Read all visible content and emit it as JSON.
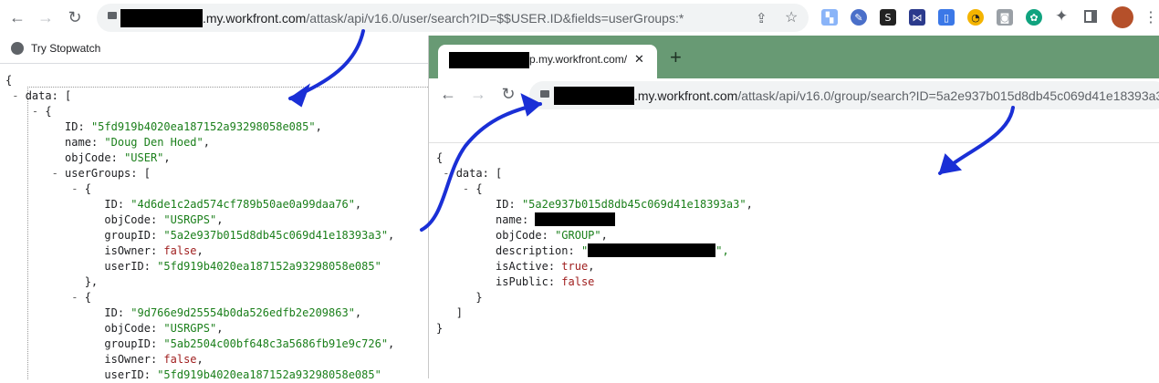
{
  "main_window": {
    "url_domain_suffix": ".my.workfront.com",
    "url_path": "/attask/api/v16.0/user/search?ID=$$USER.ID&fields=userGroups:*",
    "bookmark": {
      "label": "Try Stopwatch",
      "icon": "globe-icon"
    },
    "json_lines": [
      {
        "toggle": "",
        "indent": 0,
        "key": "",
        "value": "{",
        "vtype": "punct",
        "suffix": ""
      },
      {
        "toggle": "-",
        "indent": 1,
        "key": "data",
        "value": "[",
        "vtype": "punct",
        "suffix": ""
      },
      {
        "toggle": "-",
        "indent": 2,
        "key": "",
        "value": "{",
        "vtype": "punct",
        "suffix": ""
      },
      {
        "toggle": "",
        "indent": 3,
        "key": "ID",
        "value": "\"5fd919b4020ea187152a93298058e085\"",
        "vtype": "string",
        "suffix": ","
      },
      {
        "toggle": "",
        "indent": 3,
        "key": "name",
        "value": "\"Doug Den Hoed\"",
        "vtype": "string",
        "suffix": ","
      },
      {
        "toggle": "",
        "indent": 3,
        "key": "objCode",
        "value": "\"USER\"",
        "vtype": "string",
        "suffix": ","
      },
      {
        "toggle": "-",
        "indent": 3,
        "key": "userGroups",
        "value": "[",
        "vtype": "punct",
        "suffix": ""
      },
      {
        "toggle": "-",
        "indent": 4,
        "key": "",
        "value": "{",
        "vtype": "punct",
        "suffix": ""
      },
      {
        "toggle": "",
        "indent": 5,
        "key": "ID",
        "value": "\"4d6de1c2ad574cf789b50ae0a99daa76\"",
        "vtype": "string",
        "suffix": ","
      },
      {
        "toggle": "",
        "indent": 5,
        "key": "objCode",
        "value": "\"USRGPS\"",
        "vtype": "string",
        "suffix": ","
      },
      {
        "toggle": "",
        "indent": 5,
        "key": "groupID",
        "value": "\"5a2e937b015d8db45c069d41e18393a3\"",
        "vtype": "string",
        "suffix": ","
      },
      {
        "toggle": "",
        "indent": 5,
        "key": "isOwner",
        "value": "false",
        "vtype": "bool",
        "suffix": ","
      },
      {
        "toggle": "",
        "indent": 5,
        "key": "userID",
        "value": "\"5fd919b4020ea187152a93298058e085\"",
        "vtype": "string",
        "suffix": ""
      },
      {
        "toggle": "",
        "indent": 4,
        "key": "",
        "value": "},",
        "vtype": "punct",
        "suffix": ""
      },
      {
        "toggle": "-",
        "indent": 4,
        "key": "",
        "value": "{",
        "vtype": "punct",
        "suffix": ""
      },
      {
        "toggle": "",
        "indent": 5,
        "key": "ID",
        "value": "\"9d766e9d25554b0da526edfb2e209863\"",
        "vtype": "string",
        "suffix": ","
      },
      {
        "toggle": "",
        "indent": 5,
        "key": "objCode",
        "value": "\"USRGPS\"",
        "vtype": "string",
        "suffix": ","
      },
      {
        "toggle": "",
        "indent": 5,
        "key": "groupID",
        "value": "\"5ab2504c00bf648c3a5686fb91e9c726\"",
        "vtype": "string",
        "suffix": ","
      },
      {
        "toggle": "",
        "indent": 5,
        "key": "isOwner",
        "value": "false",
        "vtype": "bool",
        "suffix": ","
      },
      {
        "toggle": "",
        "indent": 5,
        "key": "userID",
        "value": "\"5fd919b4020ea187152a93298058e085\"",
        "vtype": "string",
        "suffix": ""
      }
    ]
  },
  "second_window": {
    "tab_title_suffix": "p.my.workfront.com/",
    "tab_close": "✕",
    "new_tab": "+",
    "url_domain_suffix": ".my.workfront.com",
    "url_path": "/attask/api/v16.0/group/search?ID=5a2e937b015d8db45c069d41e18393a3",
    "json_lines": [
      {
        "toggle": "",
        "indent": 0,
        "key": "",
        "value": "{",
        "vtype": "punct",
        "suffix": ""
      },
      {
        "toggle": "-",
        "indent": 1,
        "key": "data",
        "value": "[",
        "vtype": "punct",
        "suffix": ""
      },
      {
        "toggle": "-",
        "indent": 2,
        "key": "",
        "value": "{",
        "vtype": "punct",
        "suffix": ""
      },
      {
        "toggle": "",
        "indent": 3,
        "key": "ID",
        "value": "\"5a2e937b015d8db45c069d41e18393a3\"",
        "vtype": "string",
        "suffix": ","
      },
      {
        "toggle": "",
        "indent": 3,
        "key": "name",
        "value": "",
        "vtype": "redacted",
        "suffix": ""
      },
      {
        "toggle": "",
        "indent": 3,
        "key": "objCode",
        "value": "\"GROUP\"",
        "vtype": "string",
        "suffix": ","
      },
      {
        "toggle": "",
        "indent": 3,
        "key": "description",
        "value": "\"",
        "vtype": "redacted-str",
        "suffix": "\","
      },
      {
        "toggle": "",
        "indent": 3,
        "key": "isActive",
        "value": "true",
        "vtype": "bool",
        "suffix": ","
      },
      {
        "toggle": "",
        "indent": 3,
        "key": "isPublic",
        "value": "false",
        "vtype": "bool",
        "suffix": ""
      },
      {
        "toggle": "",
        "indent": 2,
        "key": "",
        "value": "}",
        "vtype": "punct",
        "suffix": ""
      },
      {
        "toggle": "",
        "indent": 1,
        "key": "",
        "value": "]",
        "vtype": "punct",
        "suffix": ""
      },
      {
        "toggle": "",
        "indent": 0,
        "key": "",
        "value": "}",
        "vtype": "punct",
        "suffix": ""
      }
    ]
  },
  "colors": {
    "arrow": "#1a2fd6",
    "tabstrip": "#689a74",
    "string": "#1a7f1a",
    "bool": "#a02020"
  },
  "toolbar_icons": [
    "back-icon",
    "forward-icon",
    "reload-icon",
    "lock-icon",
    "share-icon",
    "star-icon",
    "extensions-icon",
    "side-panel-icon",
    "profile-avatar"
  ]
}
